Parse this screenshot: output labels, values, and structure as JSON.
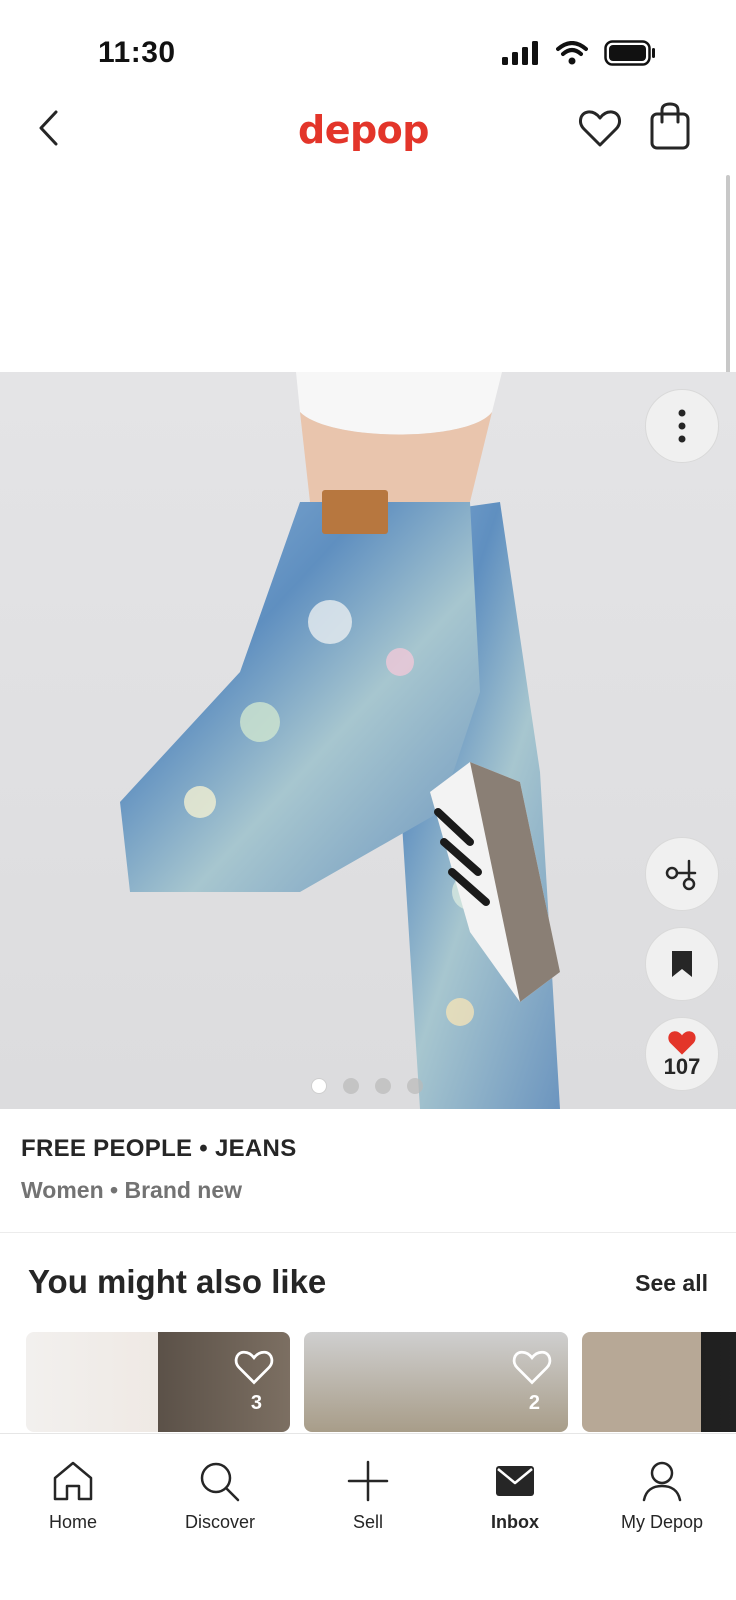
{
  "status_bar": {
    "time": "11:30"
  },
  "header": {
    "logo": "depop"
  },
  "product": {
    "image_count": 4,
    "active_image": 1,
    "likes": "107",
    "brand_line": "FREE PEOPLE • JEANS",
    "meta_line": "Women • Brand new"
  },
  "recommendations": {
    "title": "You might also like",
    "see_all": "See all",
    "items": [
      {
        "likes": "3"
      },
      {
        "likes": "2"
      },
      {
        "likes": ""
      }
    ]
  },
  "tab_bar": {
    "items": [
      {
        "label": "Home",
        "icon": "home-icon",
        "active": false
      },
      {
        "label": "Discover",
        "icon": "search-icon",
        "active": false
      },
      {
        "label": "Sell",
        "icon": "plus-icon",
        "active": false
      },
      {
        "label": "Inbox",
        "icon": "mail-icon",
        "active": true
      },
      {
        "label": "My Depop",
        "icon": "person-icon",
        "active": false
      }
    ]
  },
  "colors": {
    "brand": "#e3352a",
    "like": "#e3352a",
    "text": "#262626",
    "muted": "#737373"
  }
}
